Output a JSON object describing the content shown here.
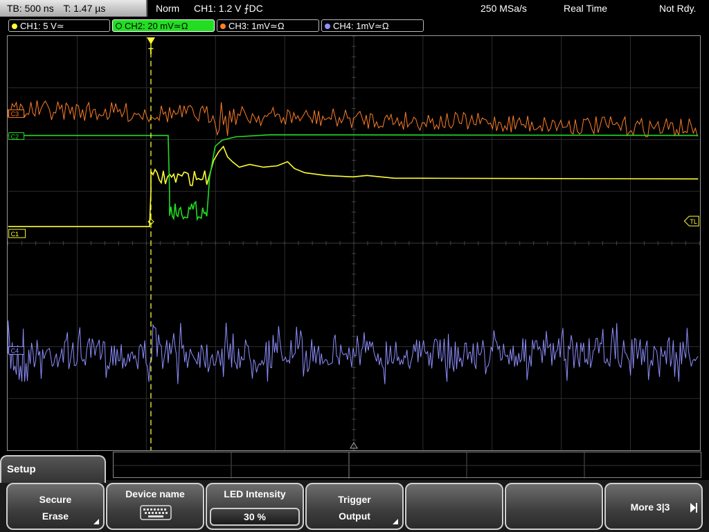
{
  "header": {
    "timebase": "TB: 500 ns",
    "trigger_time": "T: 1.47 µs",
    "acq_mode": "Norm",
    "trigger_info": "CH1: 1.2 V ⨍DC",
    "sample_rate": "250 MSa/s",
    "mode": "Real Time",
    "status": "Not Rdy."
  },
  "channels": [
    {
      "label": "CH1: 5 V≃",
      "color": "#ffff33",
      "active": false
    },
    {
      "label": "CH2: 20 mV≃Ω",
      "color": "#22dd22",
      "active": true
    },
    {
      "label": "CH3: 1mV≃Ω",
      "color": "#ff7f27",
      "active": false
    },
    {
      "label": "CH4: 1mV≃Ω",
      "color": "#8f8fff",
      "active": false
    }
  ],
  "markers": {
    "ch1": "C1",
    "ch2": "C2",
    "ch3": "C3",
    "ch4": "C4",
    "trigger_level": "TL",
    "trigger_pos": "T"
  },
  "menu": {
    "title": "Setup",
    "softkeys": [
      {
        "line1": "Secure",
        "line2": "Erase",
        "corner": true
      },
      {
        "line1": "Device name",
        "icon": "keyboard-icon"
      },
      {
        "line1": "LED Intensity",
        "value": "30 %"
      },
      {
        "line1": "Trigger",
        "line2": "Output",
        "corner": true
      },
      {
        "line1": ""
      },
      {
        "line1": ""
      },
      {
        "line1": "More 3|3",
        "arrow": true
      }
    ]
  }
}
